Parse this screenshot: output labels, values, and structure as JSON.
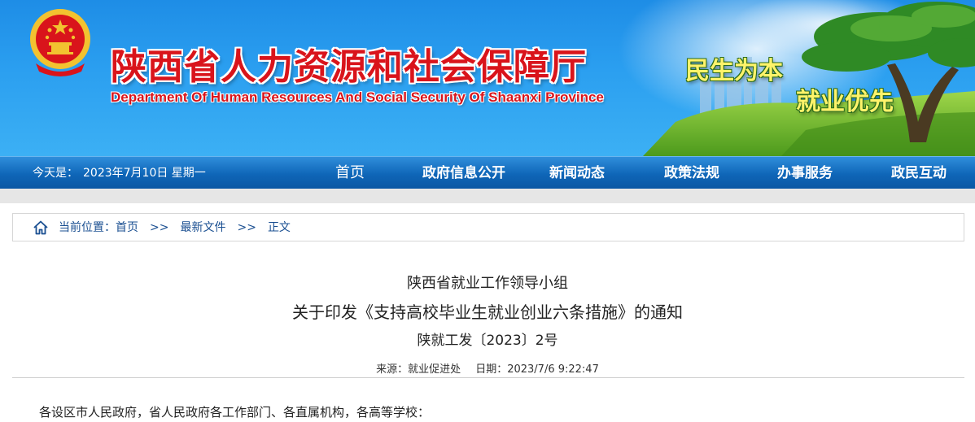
{
  "header": {
    "title": "陕西省人力资源和社会保障厅",
    "subtitle": "Department Of Human Resources And Social Security Of Shaanxi Province",
    "slogan_line1": "民生为本",
    "slogan_line2": "就业优先"
  },
  "nav": {
    "date_label": "今天是：",
    "date_value": "2023年7月10日 星期一",
    "items": [
      "首页",
      "政府信息公开",
      "新闻动态",
      "政策法规",
      "办事服务",
      "政民互动"
    ]
  },
  "breadcrumb": {
    "prefix": "当前位置：",
    "items": [
      "首页",
      "最新文件",
      "正文"
    ],
    "separator": ">>"
  },
  "article": {
    "issuer": "陕西省就业工作领导小组",
    "title": "关于印发《支持高校毕业生就业创业六条措施》的通知",
    "doc_number": "陕就工发〔2023〕2号",
    "source_label": "来源：",
    "source": "就业促进处",
    "date_label": "日期：",
    "date": "2023/7/6 9:22:47",
    "salutation": "各设区市人民政府，省人民政府各工作部门、各直属机构，各高等学校："
  },
  "colors": {
    "title_red": "#d9141b",
    "nav_blue": "#0f66b8",
    "slogan_yellow": "#fff36a",
    "link_blue": "#1a4f91"
  },
  "icons": {
    "emblem": "national-emblem-icon",
    "breadcrumb": "home-icon"
  }
}
